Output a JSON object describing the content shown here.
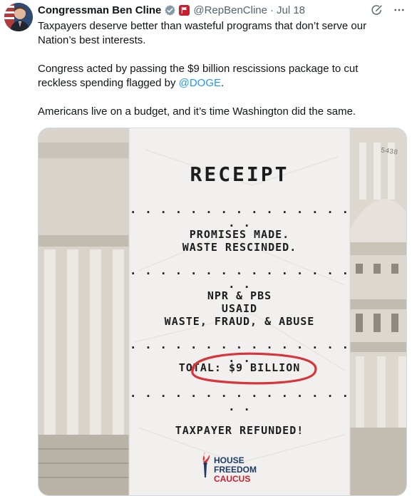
{
  "tweet": {
    "author_name": "Congressman Ben Cline",
    "handle": "@RepBenCline",
    "separator": "·",
    "date": "Jul 18",
    "paragraphs": {
      "p1": "Taxpayers deserve better than wasteful programs that don’t serve our Nation’s best interests.",
      "p2_before": "Congress acted by passing the $9 billion rescissions package to cut reckless spending flagged by ",
      "p2_mention": "@DOGE",
      "p2_after": ".",
      "p3": "Americans live on a budget, and it’s time Washington did the same."
    },
    "icons": {
      "verified": "verified-badge-icon",
      "government": "government-affiliation-icon",
      "grok": "grok-icon",
      "more": "more-icon"
    },
    "colors": {
      "link": "#1d9bf0",
      "verified_gray": "#829aab",
      "circle_red": "#d8343b"
    }
  },
  "receipt": {
    "title": "RECEIPT",
    "dots": "· · · · · · · · · · · · · · · · ·",
    "line1": "PROMISES MADE.",
    "line2": "WASTE RESCINDED.",
    "line3": "NPR & PBS",
    "line4": "USAID",
    "line5": "WASTE, FRAUD, & ABUSE",
    "total_label": "TOTAL:",
    "total_value": "$9 BILLION",
    "refund": "TAXPAYER REFUNDED!",
    "logo_line1": "HOUSE",
    "logo_line2": "FREEDOM",
    "logo_line3": "CAUCUS",
    "building_number": "5438"
  }
}
